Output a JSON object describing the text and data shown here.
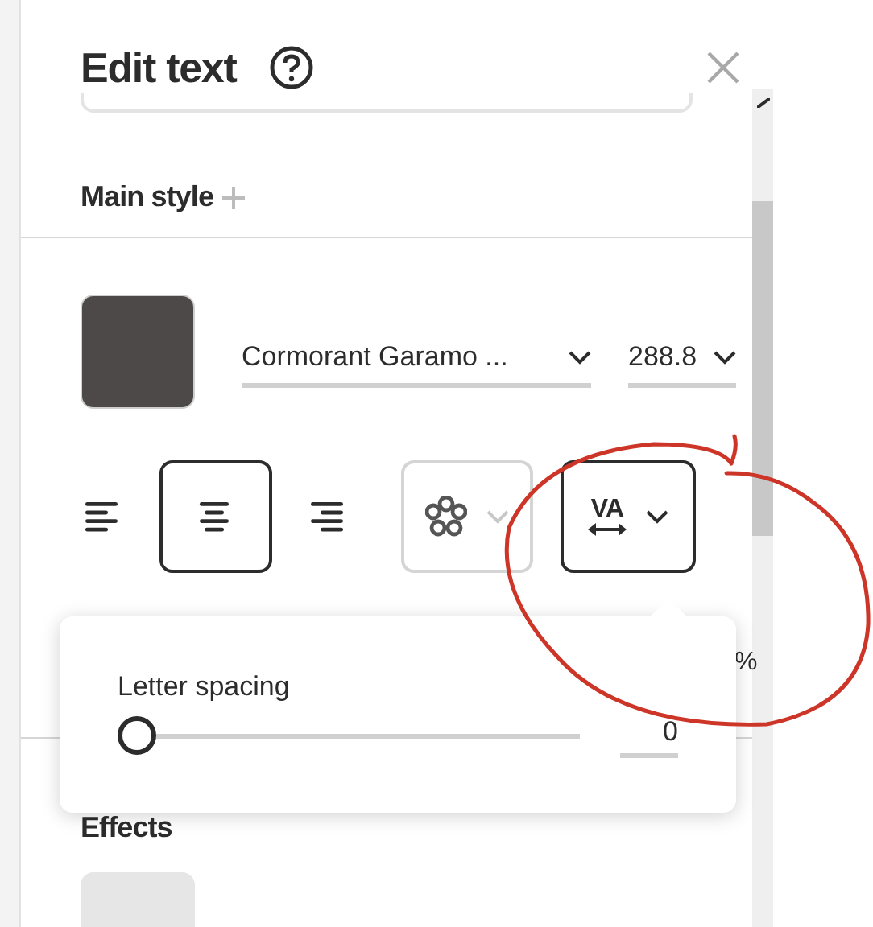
{
  "panel": {
    "title": "Edit text"
  },
  "main_style": {
    "heading": "Main style"
  },
  "font": {
    "family": "Cormorant Garamo ...",
    "size": "288.8"
  },
  "toolbar": [
    {
      "kind": "align-left",
      "selected": false
    },
    {
      "kind": "align-center",
      "selected": true
    },
    {
      "kind": "align-right",
      "selected": false
    },
    {
      "kind": "effects",
      "selected": false,
      "disabled": true
    },
    {
      "kind": "spacing",
      "selected": true,
      "glyph": "VA"
    }
  ],
  "hidden_unit": "%",
  "popover": {
    "label": "Letter spacing",
    "level": 0,
    "value": "0"
  },
  "effects": {
    "heading": "Effects"
  }
}
